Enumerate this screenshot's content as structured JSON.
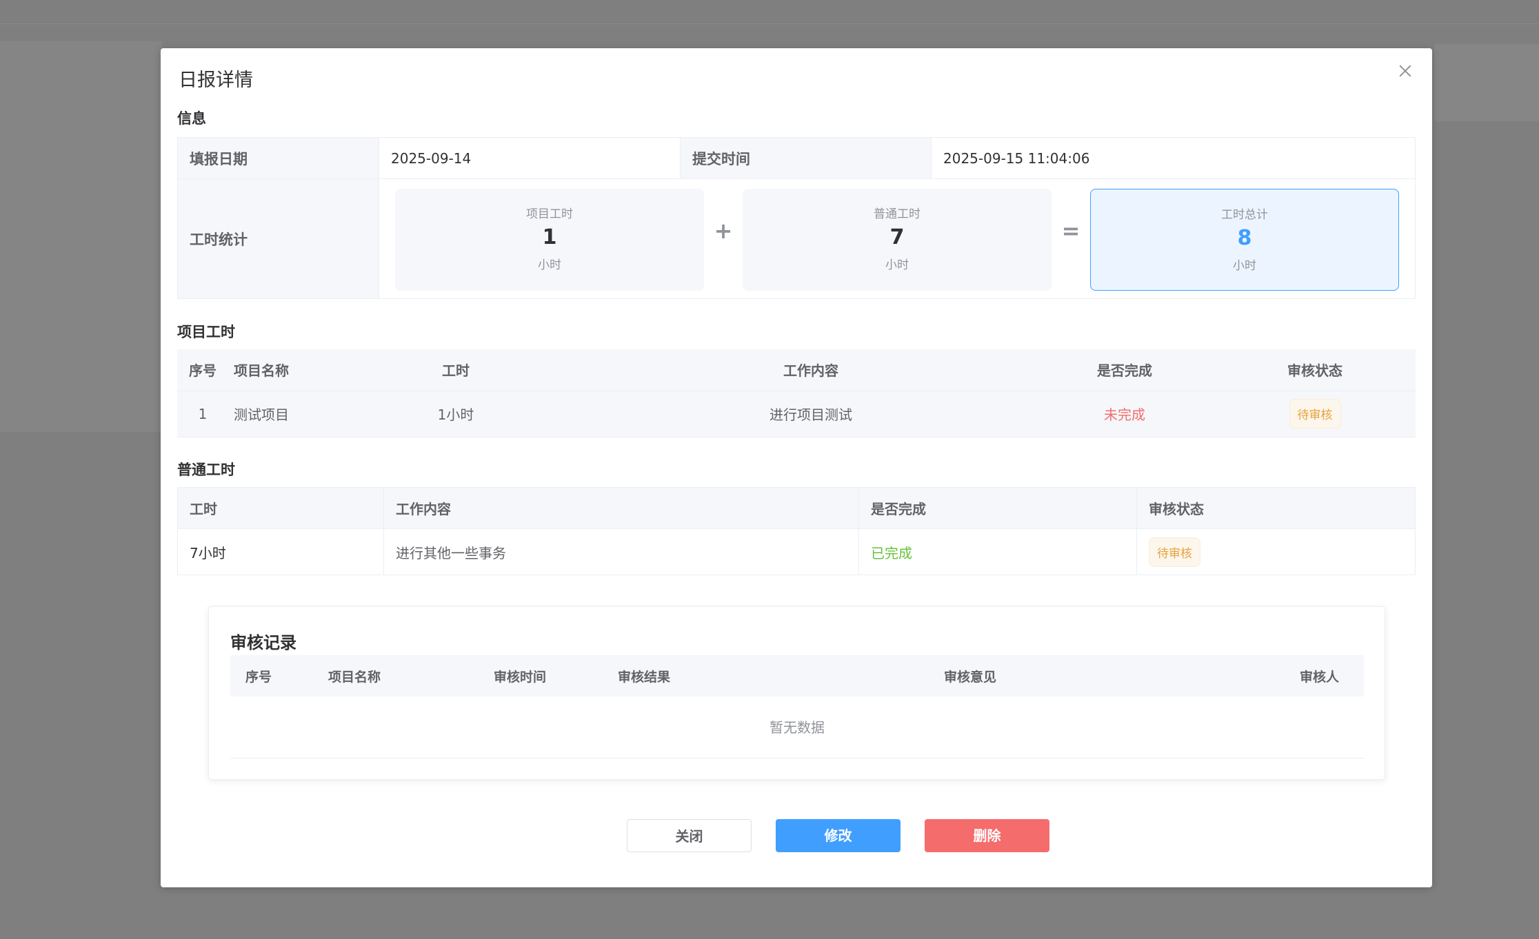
{
  "dialog": {
    "title": "日报详情",
    "info_section_title": "信息",
    "info": {
      "fill_date_label": "填报日期",
      "fill_date_value": "2025-09-14",
      "submit_time_label": "提交时间",
      "submit_time_value": "2025-09-15 11:04:06",
      "hours_stat_label": "工时统计"
    },
    "stats": {
      "project_hours": {
        "label": "项目工时",
        "value": "1",
        "unit": "小时"
      },
      "normal_hours": {
        "label": "普通工时",
        "value": "7",
        "unit": "小时"
      },
      "total_hours": {
        "label": "工时总计",
        "value": "8",
        "unit": "小时"
      },
      "plus": "+",
      "equals": "="
    },
    "project_section_title": "项目工时",
    "project_table": {
      "headers": [
        "序号",
        "项目名称",
        "工时",
        "工作内容",
        "是否完成",
        "审核状态"
      ],
      "rows": [
        {
          "index": "1",
          "name": "测试项目",
          "hours": "1小时",
          "content": "进行项目测试",
          "done": "未完成",
          "status": "待审核"
        }
      ]
    },
    "normal_section_title": "普通工时",
    "normal_table": {
      "headers": [
        "工时",
        "工作内容",
        "是否完成",
        "审核状态"
      ],
      "rows": [
        {
          "hours": "7小时",
          "content": "进行其他一些事务",
          "done": "已完成",
          "status": "待审核"
        }
      ]
    },
    "review": {
      "title": "审核记录",
      "headers": [
        "序号",
        "项目名称",
        "审核时间",
        "审核结果",
        "审核意见",
        "审核人"
      ],
      "empty_text": "暂无数据"
    },
    "buttons": {
      "close": "关闭",
      "edit": "修改",
      "delete": "删除"
    }
  },
  "colors": {
    "primary": "#409eff",
    "danger": "#f56c6c",
    "success": "#67c23a",
    "warning": "#e6a23c"
  }
}
